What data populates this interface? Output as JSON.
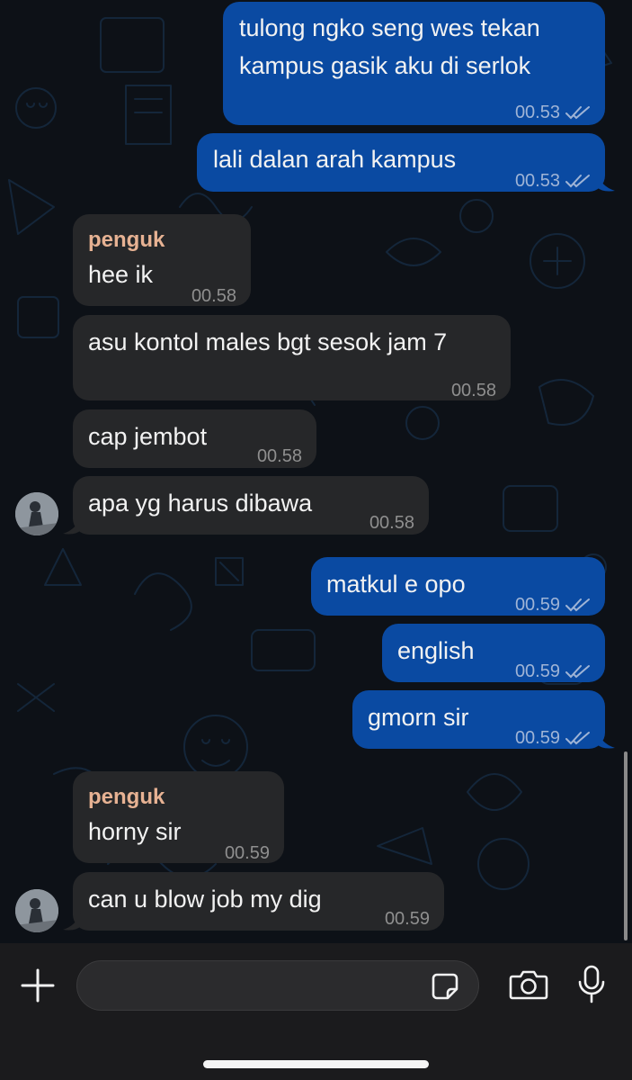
{
  "messages": [
    {
      "lines": [
        "tulong ngko seng wes tekan",
        "kampus gasik aku di serlok"
      ],
      "time": "00.53",
      "direction": "outgoing",
      "status": "read"
    },
    {
      "lines": [
        "lali dalan arah kampus"
      ],
      "time": "00.53",
      "direction": "outgoing",
      "status": "read"
    },
    {
      "sender": "penguk",
      "lines": [
        "hee ik"
      ],
      "time": "00.58",
      "direction": "incoming"
    },
    {
      "lines": [
        "asu kontol males bgt sesok jam 7"
      ],
      "time": "00.58",
      "direction": "incoming"
    },
    {
      "lines": [
        "cap jembot"
      ],
      "time": "00.58",
      "direction": "incoming"
    },
    {
      "lines": [
        "apa yg harus dibawa"
      ],
      "time": "00.58",
      "direction": "incoming"
    },
    {
      "lines": [
        "matkul e opo"
      ],
      "time": "00.59",
      "direction": "outgoing",
      "status": "read"
    },
    {
      "lines": [
        "english"
      ],
      "time": "00.59",
      "direction": "outgoing",
      "status": "read"
    },
    {
      "lines": [
        "gmorn sir"
      ],
      "time": "00.59",
      "direction": "outgoing",
      "status": "read"
    },
    {
      "sender": "penguk",
      "lines": [
        "horny sir"
      ],
      "time": "00.59",
      "direction": "incoming"
    },
    {
      "lines": [
        "can u blow job my dig"
      ],
      "time": "00.59",
      "direction": "incoming"
    }
  ],
  "composer": {
    "placeholder": "",
    "icons": [
      "plus-icon",
      "sticker-icon",
      "camera-icon",
      "microphone-icon"
    ]
  },
  "colors": {
    "outgoing_bubble": "#0a4aa2",
    "incoming_bubble": "#262729",
    "sender_name": "#e7b293",
    "chat_background": "#0d1117",
    "composer_background": "#1b1b1d"
  }
}
